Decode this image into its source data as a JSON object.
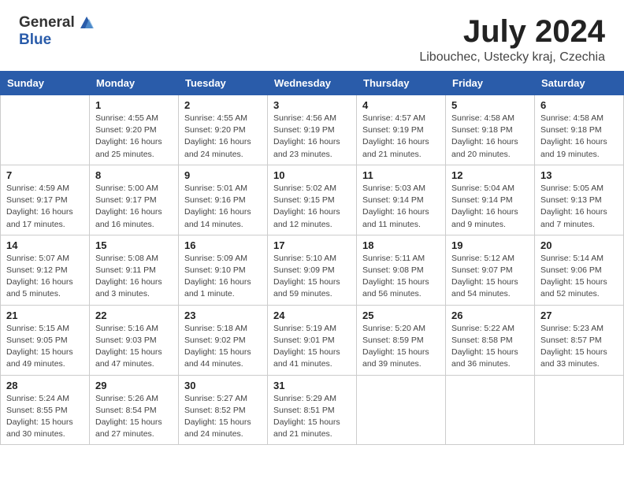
{
  "header": {
    "logo_general": "General",
    "logo_blue": "Blue",
    "month": "July 2024",
    "location": "Libouchec, Ustecky kraj, Czechia"
  },
  "days_of_week": [
    "Sunday",
    "Monday",
    "Tuesday",
    "Wednesday",
    "Thursday",
    "Friday",
    "Saturday"
  ],
  "weeks": [
    [
      {
        "day": "",
        "info": ""
      },
      {
        "day": "1",
        "info": "Sunrise: 4:55 AM\nSunset: 9:20 PM\nDaylight: 16 hours\nand 25 minutes."
      },
      {
        "day": "2",
        "info": "Sunrise: 4:55 AM\nSunset: 9:20 PM\nDaylight: 16 hours\nand 24 minutes."
      },
      {
        "day": "3",
        "info": "Sunrise: 4:56 AM\nSunset: 9:19 PM\nDaylight: 16 hours\nand 23 minutes."
      },
      {
        "day": "4",
        "info": "Sunrise: 4:57 AM\nSunset: 9:19 PM\nDaylight: 16 hours\nand 21 minutes."
      },
      {
        "day": "5",
        "info": "Sunrise: 4:58 AM\nSunset: 9:18 PM\nDaylight: 16 hours\nand 20 minutes."
      },
      {
        "day": "6",
        "info": "Sunrise: 4:58 AM\nSunset: 9:18 PM\nDaylight: 16 hours\nand 19 minutes."
      }
    ],
    [
      {
        "day": "7",
        "info": "Sunrise: 4:59 AM\nSunset: 9:17 PM\nDaylight: 16 hours\nand 17 minutes."
      },
      {
        "day": "8",
        "info": "Sunrise: 5:00 AM\nSunset: 9:17 PM\nDaylight: 16 hours\nand 16 minutes."
      },
      {
        "day": "9",
        "info": "Sunrise: 5:01 AM\nSunset: 9:16 PM\nDaylight: 16 hours\nand 14 minutes."
      },
      {
        "day": "10",
        "info": "Sunrise: 5:02 AM\nSunset: 9:15 PM\nDaylight: 16 hours\nand 12 minutes."
      },
      {
        "day": "11",
        "info": "Sunrise: 5:03 AM\nSunset: 9:14 PM\nDaylight: 16 hours\nand 11 minutes."
      },
      {
        "day": "12",
        "info": "Sunrise: 5:04 AM\nSunset: 9:14 PM\nDaylight: 16 hours\nand 9 minutes."
      },
      {
        "day": "13",
        "info": "Sunrise: 5:05 AM\nSunset: 9:13 PM\nDaylight: 16 hours\nand 7 minutes."
      }
    ],
    [
      {
        "day": "14",
        "info": "Sunrise: 5:07 AM\nSunset: 9:12 PM\nDaylight: 16 hours\nand 5 minutes."
      },
      {
        "day": "15",
        "info": "Sunrise: 5:08 AM\nSunset: 9:11 PM\nDaylight: 16 hours\nand 3 minutes."
      },
      {
        "day": "16",
        "info": "Sunrise: 5:09 AM\nSunset: 9:10 PM\nDaylight: 16 hours\nand 1 minute."
      },
      {
        "day": "17",
        "info": "Sunrise: 5:10 AM\nSunset: 9:09 PM\nDaylight: 15 hours\nand 59 minutes."
      },
      {
        "day": "18",
        "info": "Sunrise: 5:11 AM\nSunset: 9:08 PM\nDaylight: 15 hours\nand 56 minutes."
      },
      {
        "day": "19",
        "info": "Sunrise: 5:12 AM\nSunset: 9:07 PM\nDaylight: 15 hours\nand 54 minutes."
      },
      {
        "day": "20",
        "info": "Sunrise: 5:14 AM\nSunset: 9:06 PM\nDaylight: 15 hours\nand 52 minutes."
      }
    ],
    [
      {
        "day": "21",
        "info": "Sunrise: 5:15 AM\nSunset: 9:05 PM\nDaylight: 15 hours\nand 49 minutes."
      },
      {
        "day": "22",
        "info": "Sunrise: 5:16 AM\nSunset: 9:03 PM\nDaylight: 15 hours\nand 47 minutes."
      },
      {
        "day": "23",
        "info": "Sunrise: 5:18 AM\nSunset: 9:02 PM\nDaylight: 15 hours\nand 44 minutes."
      },
      {
        "day": "24",
        "info": "Sunrise: 5:19 AM\nSunset: 9:01 PM\nDaylight: 15 hours\nand 41 minutes."
      },
      {
        "day": "25",
        "info": "Sunrise: 5:20 AM\nSunset: 8:59 PM\nDaylight: 15 hours\nand 39 minutes."
      },
      {
        "day": "26",
        "info": "Sunrise: 5:22 AM\nSunset: 8:58 PM\nDaylight: 15 hours\nand 36 minutes."
      },
      {
        "day": "27",
        "info": "Sunrise: 5:23 AM\nSunset: 8:57 PM\nDaylight: 15 hours\nand 33 minutes."
      }
    ],
    [
      {
        "day": "28",
        "info": "Sunrise: 5:24 AM\nSunset: 8:55 PM\nDaylight: 15 hours\nand 30 minutes."
      },
      {
        "day": "29",
        "info": "Sunrise: 5:26 AM\nSunset: 8:54 PM\nDaylight: 15 hours\nand 27 minutes."
      },
      {
        "day": "30",
        "info": "Sunrise: 5:27 AM\nSunset: 8:52 PM\nDaylight: 15 hours\nand 24 minutes."
      },
      {
        "day": "31",
        "info": "Sunrise: 5:29 AM\nSunset: 8:51 PM\nDaylight: 15 hours\nand 21 minutes."
      },
      {
        "day": "",
        "info": ""
      },
      {
        "day": "",
        "info": ""
      },
      {
        "day": "",
        "info": ""
      }
    ]
  ]
}
